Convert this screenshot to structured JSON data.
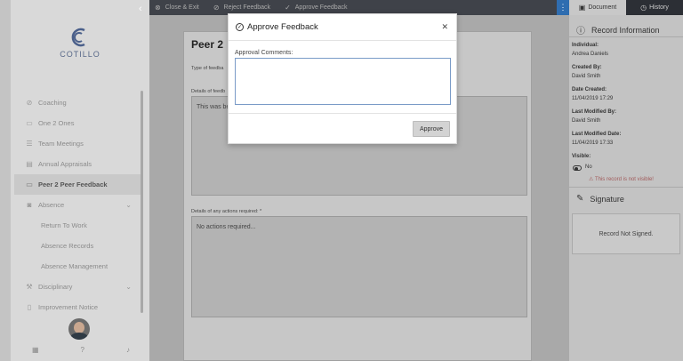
{
  "sidebar": {
    "brand": "COTILLO",
    "items": [
      {
        "label": "Coaching",
        "icon": "coaching-icon"
      },
      {
        "label": "One 2 Ones",
        "icon": "one2ones-icon"
      },
      {
        "label": "Team Meetings",
        "icon": "meetings-icon"
      },
      {
        "label": "Annual Appraisals",
        "icon": "appraisals-icon"
      },
      {
        "label": "Peer 2 Peer Feedback",
        "icon": "feedback-icon"
      },
      {
        "label": "Absence",
        "icon": "absence-icon"
      },
      {
        "label": "Return To Work"
      },
      {
        "label": "Absence Records"
      },
      {
        "label": "Absence Management"
      },
      {
        "label": "Disciplinary",
        "icon": "disciplinary-icon"
      },
      {
        "label": "Improvement Notice",
        "icon": "notice-icon"
      }
    ]
  },
  "toolbar": {
    "close_exit": "Close & Exit",
    "reject": "Reject Feedback",
    "approve": "Approve Feedback"
  },
  "form": {
    "title": "Peer 2",
    "type_label": "Type of feedba",
    "details_label": "Details of feedb",
    "details_value": "This was be",
    "actions_label": "Details of any actions required: *",
    "actions_value": "No actions required..."
  },
  "right_panel": {
    "tab_document": "Document",
    "tab_history": "History",
    "record_title": "Record Information",
    "individual_label": "Individual:",
    "individual_value": "Andrea Daniels",
    "created_by_label": "Created By:",
    "created_by_value": "David Smith",
    "date_created_label": "Date Created:",
    "date_created_value": "11/04/2019 17:29",
    "last_modified_by_label": "Last Modified By:",
    "last_modified_by_value": "David Smith",
    "last_modified_date_label": "Last Modified Date:",
    "last_modified_date_value": "11/04/2019 17:33",
    "visible_label": "Visible:",
    "visible_value": "No",
    "visible_warning": "This record is not visible!",
    "signature_title": "Signature",
    "signature_status": "Record Not Signed."
  },
  "modal": {
    "title": "Approve Feedback",
    "comments_label": "Approval Comments:",
    "comments_value": "",
    "approve_button": "Approve"
  },
  "colors": {
    "accent": "#2f6db0",
    "toolbar": "#3f4249",
    "warning": "#a15a5a"
  }
}
